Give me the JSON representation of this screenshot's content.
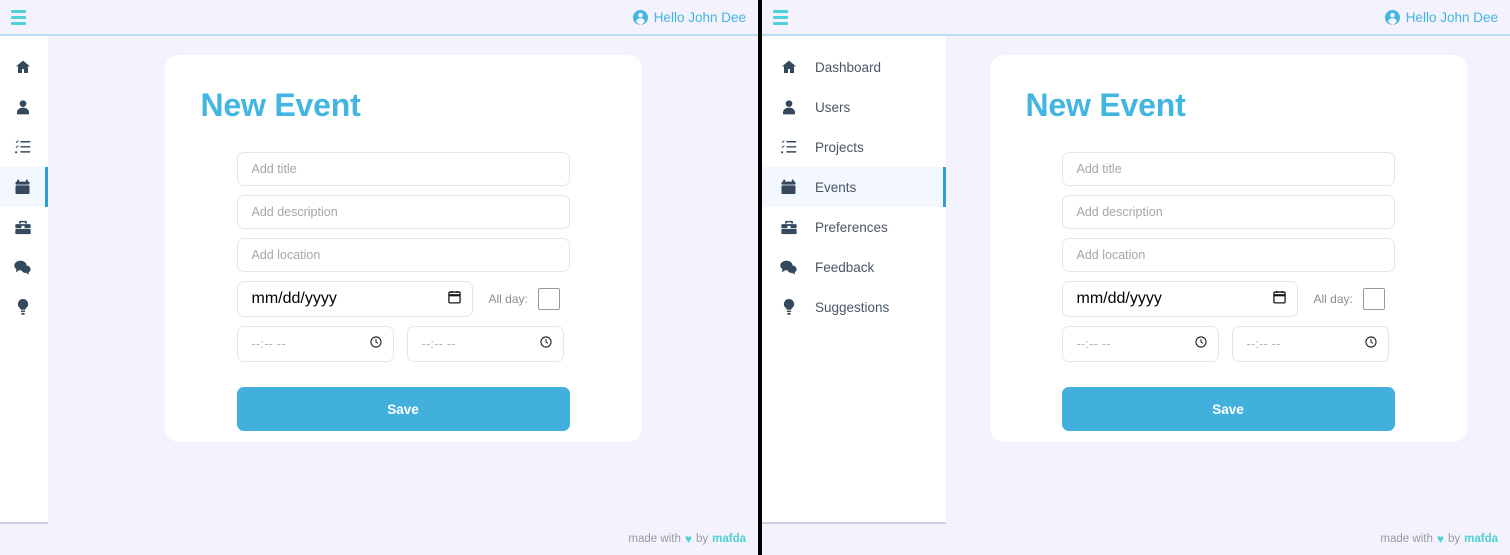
{
  "header": {
    "menu_icon": "hamburger-icon",
    "user_icon": "user-circle-icon",
    "greeting": "Hello John Dee"
  },
  "sidebar": {
    "items": [
      {
        "icon": "home-icon",
        "label": "Dashboard",
        "active": false
      },
      {
        "icon": "user-icon",
        "label": "Users",
        "active": false
      },
      {
        "icon": "tasks-list-icon",
        "label": "Projects",
        "active": false
      },
      {
        "icon": "calendar-icon",
        "label": "Events",
        "active": true
      },
      {
        "icon": "toolbox-icon",
        "label": "Preferences",
        "active": false
      },
      {
        "icon": "comments-icon",
        "label": "Feedback",
        "active": false
      },
      {
        "icon": "lightbulb-icon",
        "label": "Suggestions",
        "active": false
      }
    ]
  },
  "form": {
    "title": "New Event",
    "title_field": {
      "value": "",
      "placeholder": "Add title"
    },
    "description_field": {
      "value": "",
      "placeholder": "Add description"
    },
    "location_field": {
      "value": "",
      "placeholder": "Add location"
    },
    "date_field": {
      "value": "",
      "placeholder": "mm/dd/yyyy",
      "icon": "calendar-picker-icon"
    },
    "all_day_label": "All day:",
    "all_day_checked": false,
    "start_time_field": {
      "value": "",
      "placeholder": "--:-- --",
      "icon": "clock-picker-icon"
    },
    "end_time_field": {
      "value": "",
      "placeholder": "--:-- --",
      "icon": "clock-picker-icon"
    },
    "save_label": "Save"
  },
  "footer": {
    "prefix": "made with",
    "heart": "♥",
    "middle": "by",
    "brand": "mafda"
  },
  "colors": {
    "accent_blue": "#42b6e0",
    "accent_teal": "#4fd1d9",
    "page_bg": "#f4f2fd",
    "card_bg": "#ffffff",
    "active_nav_bg": "#f3f7fe",
    "active_nav_border": "#2e9dd0",
    "nav_text": "#4a5665",
    "placeholder": "#a6a6aa",
    "divider": "#000000"
  }
}
